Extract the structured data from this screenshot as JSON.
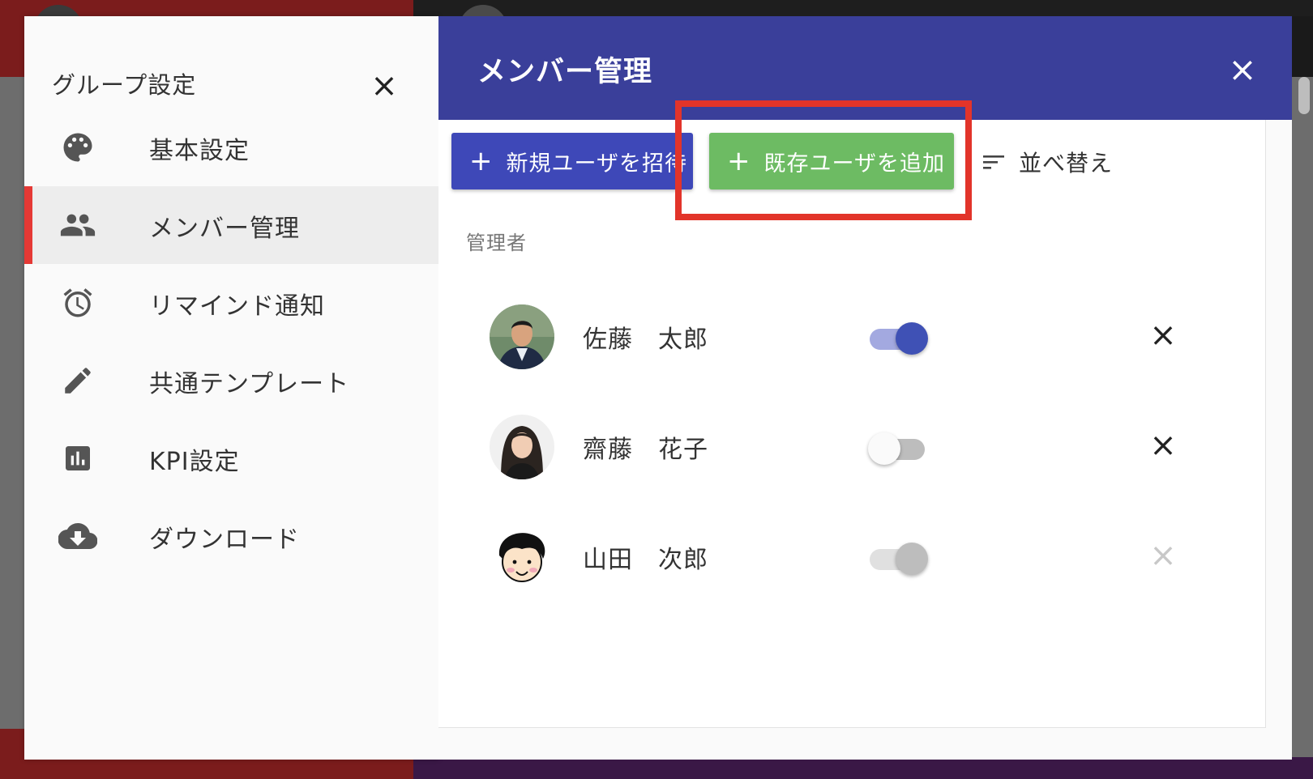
{
  "left_panel": {
    "title": "グループ設定",
    "close_glyph": "×",
    "menu": [
      {
        "label": "基本設定",
        "icon": "palette-icon",
        "active": false
      },
      {
        "label": "メンバー管理",
        "icon": "people-icon",
        "active": true
      },
      {
        "label": "リマインド通知",
        "icon": "alarm-icon",
        "active": false
      },
      {
        "label": "共通テンプレート",
        "icon": "pencil-icon",
        "active": false
      },
      {
        "label": "KPI設定",
        "icon": "bar-chart-icon",
        "active": false
      },
      {
        "label": "ダウンロード",
        "icon": "cloud-download-icon",
        "active": false
      }
    ]
  },
  "right_panel": {
    "title": "メンバー管理",
    "close_glyph": "×",
    "actions": {
      "plus_glyph": "+",
      "invite_label": "新規ユーザを招待",
      "add_existing_label": "既存ユーザを追加",
      "sort_label": "並べ替え"
    },
    "section_label": "管理者",
    "members": [
      {
        "name": "佐藤　太郎",
        "toggle_on": true,
        "toggle_disabled": false,
        "remove_glyph": "×",
        "remove_disabled": false
      },
      {
        "name": "齋藤　花子",
        "toggle_on": false,
        "toggle_disabled": false,
        "remove_glyph": "×",
        "remove_disabled": false
      },
      {
        "name": "山田　次郎",
        "toggle_on": false,
        "toggle_disabled": true,
        "remove_glyph": "×",
        "remove_disabled": true
      }
    ]
  },
  "colors": {
    "header": "#3a3f9a",
    "primary_button": "#3e48b8",
    "success_button": "#6dbb63",
    "active_indicator": "#e53935",
    "highlight": "#e2342a",
    "toggle_on_thumb": "#3f51b5",
    "toggle_on_track": "#a3a9e0"
  }
}
